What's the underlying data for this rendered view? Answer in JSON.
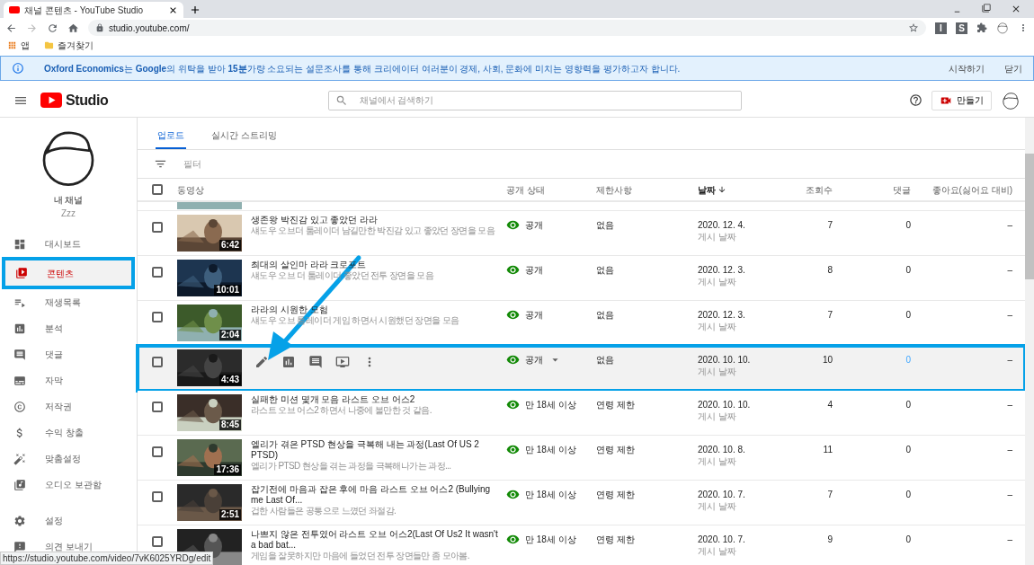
{
  "browser": {
    "tab_title": "채널 콘텐츠 - YouTube Studio",
    "url": "studio.youtube.com/",
    "extensions": [
      "I",
      "S"
    ],
    "bookmarks": [
      "앱",
      "즐겨찾기"
    ],
    "status_url": "https://studio.youtube.com/video/7vK6025YRDg/edit"
  },
  "banner": {
    "text": "**Oxford Economics**는 **Google**의 위탁을 받아 **15분**가량 소요되는 설문조사를 통해 크리에이터 여러분이 경제, 사회, 문화에 미치는 영향력을 평가하고자 합니다.",
    "actions": [
      "시작하기",
      "닫기"
    ]
  },
  "header": {
    "logo_text": "Studio",
    "search_placeholder": "채널에서 검색하기",
    "create_label": "만들기"
  },
  "channel": {
    "name": "내 채널",
    "handle": "Zzz"
  },
  "sidebar": {
    "items": [
      {
        "label": "대시보드",
        "selected": false,
        "highlighted": false
      },
      {
        "label": "콘텐츠",
        "selected": true,
        "highlighted": true
      },
      {
        "label": "재생목록",
        "selected": false,
        "highlighted": false
      },
      {
        "label": "분석",
        "selected": false,
        "highlighted": false
      },
      {
        "label": "댓글",
        "selected": false,
        "highlighted": false
      },
      {
        "label": "자막",
        "selected": false,
        "highlighted": false
      },
      {
        "label": "저작권",
        "selected": false,
        "highlighted": false
      },
      {
        "label": "수익 창출",
        "selected": false,
        "highlighted": false
      },
      {
        "label": "맞춤설정",
        "selected": false,
        "highlighted": false
      },
      {
        "label": "오디오 보관함",
        "selected": false,
        "highlighted": false
      }
    ],
    "bottom_items": [
      {
        "label": "설정"
      },
      {
        "label": "의견 보내기"
      }
    ]
  },
  "tabs": [
    {
      "label": "업로드",
      "selected": true
    },
    {
      "label": "실시간 스트리밍",
      "selected": false
    }
  ],
  "filter": {
    "placeholder": "필터"
  },
  "table": {
    "all_checked": false,
    "columns": [
      "동영상",
      "공개 상태",
      "제한사항",
      "날짜",
      "조회수",
      "댓글",
      "좋아요(싫어요 대비)"
    ],
    "rows": [
      {
        "title": "생존왕 박진감 있고 좋았던 라라",
        "description": "섀도우 오브더 툼레이더 남길만한 박진감 있고 좋았던 장면을 모음",
        "duration": "6:42",
        "visibility": "공개",
        "restriction": "없음",
        "date": "2020. 12. 4.",
        "date_note": "게시 날짜",
        "views": "7",
        "comments": "0",
        "likes": "–",
        "hovered": false,
        "highlighted": false,
        "checked": false
      },
      {
        "title": "최대의 살인마 라라 크로포트",
        "description": "섀도우 오브 더 툼레이더 좋았던 전투 장면을 모음",
        "duration": "10:01",
        "visibility": "공개",
        "restriction": "없음",
        "date": "2020. 12. 3.",
        "date_note": "게시 날짜",
        "views": "8",
        "comments": "0",
        "likes": "–",
        "hovered": false,
        "highlighted": false,
        "checked": false
      },
      {
        "title": "라라의 시원한 모험",
        "description": "섀도우 오브 툼레이더 게임 하면서 시원했던 장면을 모음",
        "duration": "2:04",
        "visibility": "공개",
        "restriction": "없음",
        "date": "2020. 12. 3.",
        "date_note": "게시 날짜",
        "views": "7",
        "comments": "0",
        "likes": "–",
        "hovered": false,
        "highlighted": false,
        "checked": false
      },
      {
        "duration": "4:43",
        "visibility": "공개",
        "restriction": "없음",
        "date": "2020. 10. 10.",
        "date_note": "게시 날짜",
        "views": "10",
        "comments": "0",
        "likes": "–",
        "hovered": true,
        "highlighted": true,
        "checked": false
      },
      {
        "title": "실패한 미션 몇개 모음 라스트 오브 어스2",
        "description": "라스트 오브 어스2 하면서 나중에 불만한 것 같음.",
        "duration": "8:45",
        "visibility": "만 18세 이상",
        "restriction": "연령 제한",
        "date": "2020. 10. 10.",
        "date_note": "게시 날짜",
        "views": "4",
        "comments": "0",
        "likes": "–",
        "hovered": false,
        "highlighted": false,
        "checked": false
      },
      {
        "title": "엘리가 겪은 PTSD 현상을 극복해 내는 과정(Last Of US 2 PTSD)",
        "description": "엘리가 PTSD 현상을 겪는 과정을 극복해나가는 과정...",
        "duration": "17:36",
        "visibility": "만 18세 이상",
        "restriction": "연령 제한",
        "date": "2020. 10. 8.",
        "date_note": "게시 날짜",
        "views": "11",
        "comments": "0",
        "likes": "–",
        "hovered": false,
        "highlighted": false,
        "checked": false
      },
      {
        "title": "잡기전에 마음과 잡은 후에 마음 라스트 오브 어스2 (Bullying me Last Of...",
        "description": "겁한 사람들은 공통으로 느꼈던 좌절감.",
        "duration": "2:51",
        "visibility": "만 18세 이상",
        "restriction": "연령 제한",
        "date": "2020. 10. 7.",
        "date_note": "게시 날짜",
        "views": "7",
        "comments": "0",
        "likes": "–",
        "hovered": false,
        "highlighted": false,
        "checked": false
      },
      {
        "title": "나쁘지 않은 전투였어 라스트 오브 어스2(Last Of Us2 It wasn't a bad bat...",
        "description": "게임을 잘못하지만 마음에 들었던 전투 장면들만 좀 모아봄.",
        "visibility": "만 18세 이상",
        "restriction": "연령 제한",
        "date": "2020. 10. 7.",
        "date_note": "게시 날짜",
        "views": "9",
        "comments": "0",
        "likes": "–",
        "hovered": false,
        "highlighted": false,
        "checked": false
      }
    ]
  }
}
